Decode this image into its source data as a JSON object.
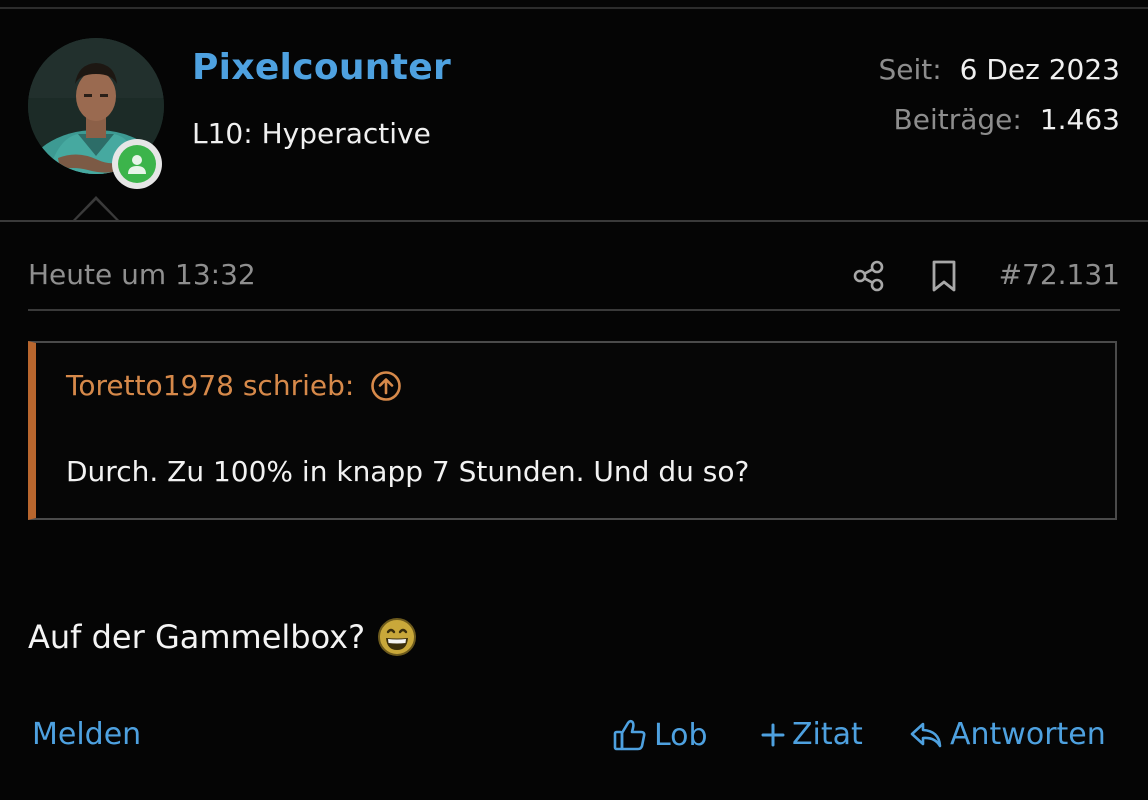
{
  "user": {
    "name": "Pixelcounter",
    "title": "L10: Hyperactive",
    "since_label": "Seit:",
    "since_value": "6 Dez 2023",
    "posts_label": "Beiträge:",
    "posts_value": "1.463"
  },
  "post": {
    "date": "Heute um 13:32",
    "number": "#72.131",
    "quote": {
      "author": "Toretto1978 schrieb:",
      "text": "Durch. Zu 100% in knapp 7 Stunden. Und du so?"
    },
    "body": "Auf der Gammelbox?"
  },
  "actions": {
    "report": "Melden",
    "like": "Lob",
    "quote": "Zitat",
    "reply": "Antworten"
  },
  "icons": {
    "share": "share-icon",
    "bookmark": "bookmark-icon",
    "quote_up": "arrow-up-circle-icon",
    "online": "user-online-icon",
    "like": "thumbs-up-icon",
    "plus": "plus-icon",
    "reply": "reply-icon",
    "smiley": "grin-smiley-icon"
  },
  "colors": {
    "background": "#050505",
    "link": "#4ea1e0",
    "quote_accent": "#b8662e",
    "quote_author": "#d6894a",
    "online": "#3cb44b"
  }
}
